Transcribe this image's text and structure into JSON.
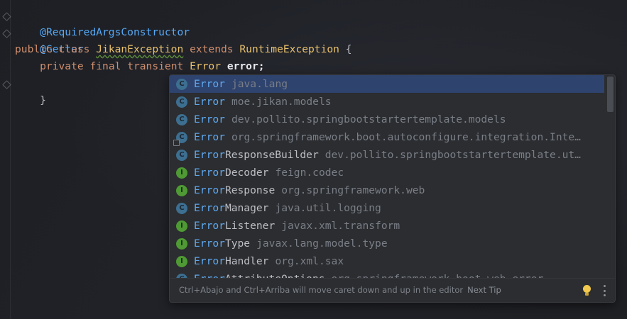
{
  "code": {
    "line1": "@RequiredArgsConstructor",
    "line2": "@Getter",
    "line3_kw1": "public",
    "line3_kw2": "class",
    "line3_cls": "JikanException",
    "line3_kw3": "extends",
    "line3_super": "RuntimeException",
    "line3_brace": "{",
    "line4_kw1": "private",
    "line4_kw2": "final",
    "line4_kw3": "transient",
    "line4_type": "Error",
    "line4_field": "error",
    "line4_semi": ";",
    "line5": "}"
  },
  "completion": {
    "items": [
      {
        "kind": "C",
        "match": "Error",
        "rest": "",
        "pkg": "java.lang"
      },
      {
        "kind": "C",
        "match": "Error",
        "rest": "",
        "pkg": "moe.jikan.models"
      },
      {
        "kind": "C",
        "match": "Error",
        "rest": "",
        "pkg": "dev.pollito.springbootstartertemplate.models"
      },
      {
        "kind": "C",
        "match": "Error",
        "rest": "",
        "pkg": "org.springframework.boot.autoconfigure.integration.Inte…"
      },
      {
        "kind": "C",
        "match": "Error",
        "rest": "ResponseBuilder",
        "pkg": "dev.pollito.springbootstartertemplate.ut…"
      },
      {
        "kind": "I",
        "match": "Error",
        "rest": "Decoder",
        "pkg": "feign.codec"
      },
      {
        "kind": "I",
        "match": "Error",
        "rest": "Response",
        "pkg": "org.springframework.web"
      },
      {
        "kind": "C",
        "match": "Error",
        "rest": "Manager",
        "pkg": "java.util.logging"
      },
      {
        "kind": "I",
        "match": "Error",
        "rest": "Listener",
        "pkg": "javax.xml.transform"
      },
      {
        "kind": "I",
        "match": "Error",
        "rest": "Type",
        "pkg": "javax.lang.model.type"
      },
      {
        "kind": "I",
        "match": "Error",
        "rest": "Handler",
        "pkg": "org.xml.sax"
      },
      {
        "kind": "C",
        "match": "Error",
        "rest": "AttributeOptions",
        "pkg": "org.springframework.boot.web.error"
      }
    ],
    "footer_hint": "Ctrl+Abajo and Ctrl+Arriba will move caret down and up in the editor",
    "next_tip": "Next Tip"
  },
  "colors": {
    "selection": "#2e436e",
    "match": "#5fa8f0",
    "annotation": "#56a8f5",
    "keyword": "#cf8e6d",
    "class": "#e8c06c"
  },
  "icons": {
    "class_badge": "class-icon",
    "interface_badge": "interface-icon",
    "tip": "lightbulb-icon",
    "menu": "more-vertical-icon"
  }
}
